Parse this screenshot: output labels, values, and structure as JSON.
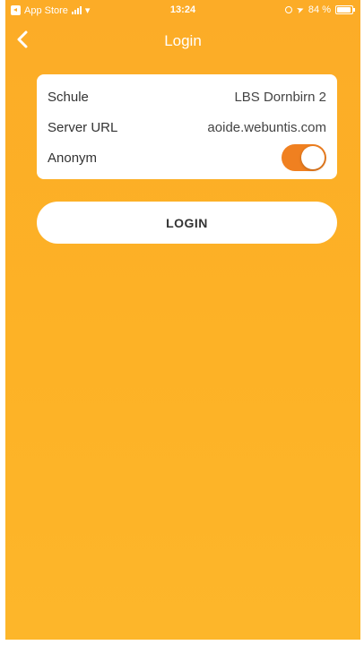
{
  "statusbar": {
    "carrier": "App Store",
    "time": "13:24",
    "battery": "84 %"
  },
  "navbar": {
    "title": "Login"
  },
  "form": {
    "rows": [
      {
        "label": "Schule",
        "value": "LBS Dornbirn 2"
      },
      {
        "label": "Server URL",
        "value": "aoide.webuntis.com"
      },
      {
        "label": "Anonym",
        "toggle_on": true
      }
    ]
  },
  "login_button": "LOGIN",
  "colors": {
    "background": "#fcac27",
    "toggle": "#f08020",
    "text": "#333333"
  }
}
